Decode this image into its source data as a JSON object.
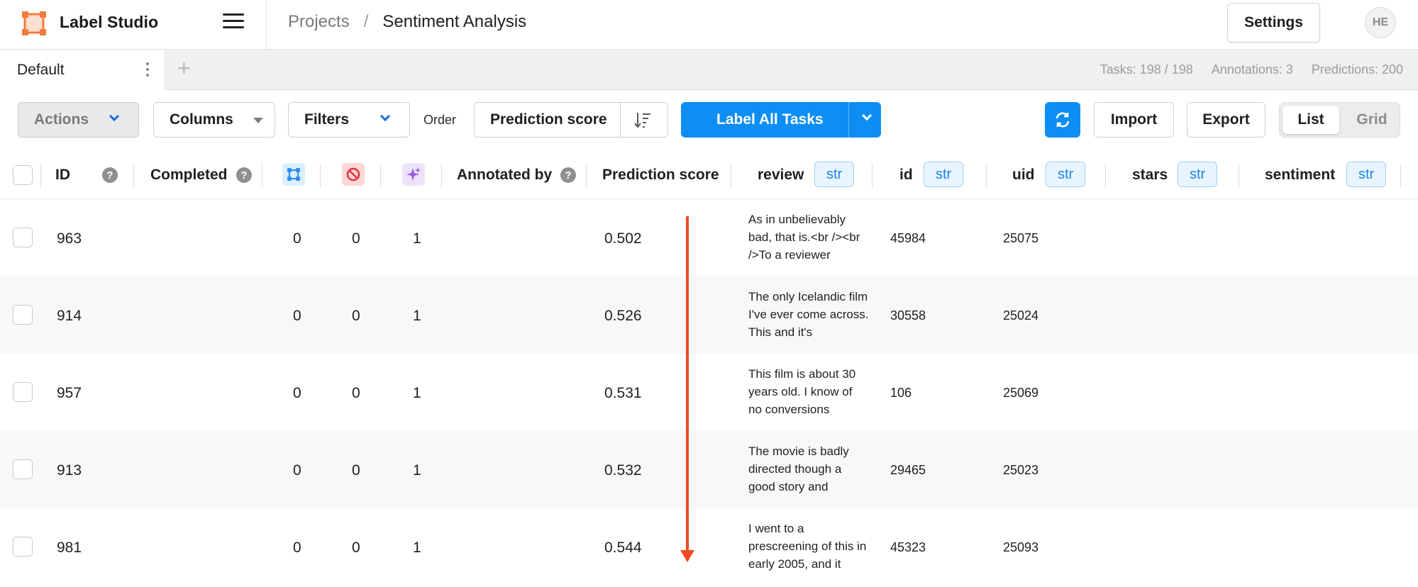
{
  "app": {
    "title": "Label Studio"
  },
  "breadcrumb": {
    "projects": "Projects",
    "separator": "/",
    "current": "Sentiment Analysis"
  },
  "header": {
    "settings_label": "Settings",
    "avatar_initials": "HE"
  },
  "tabs": {
    "active_label": "Default",
    "add_symbol": "+"
  },
  "stats": {
    "tasks": "Tasks: 198 / 198",
    "annotations": "Annotations: 3",
    "predictions": "Predictions: 200"
  },
  "toolbar": {
    "actions_label": "Actions",
    "columns_label": "Columns",
    "filters_label": "Filters",
    "order_label": "Order",
    "order_field": "Prediction score",
    "label_all_label": "Label All Tasks",
    "import_label": "Import",
    "export_label": "Export",
    "view_list_label": "List",
    "view_grid_label": "Grid",
    "accent_color": "#0c8ef5"
  },
  "table": {
    "columns": {
      "id": "ID",
      "completed": "Completed",
      "annotated_by": "Annotated by",
      "prediction_score": "Prediction score",
      "review": "review",
      "review_type": "str",
      "data_id": "id",
      "data_id_type": "str",
      "uid": "uid",
      "uid_type": "str",
      "stars": "stars",
      "stars_type": "str",
      "sentiment": "sentiment",
      "sentiment_type": "str",
      "help_symbol": "?"
    },
    "header_icons": [
      "annotations-count-icon",
      "cancelled-count-icon",
      "predictions-count-icon"
    ],
    "rows": [
      {
        "id": "963",
        "annotations": "0",
        "cancelled": "0",
        "predictions": "1",
        "score": "0.502",
        "review": "As in unbelievably bad, that is.<br /><br />To a reviewer",
        "data_id": "45984",
        "uid": "25075"
      },
      {
        "id": "914",
        "annotations": "0",
        "cancelled": "0",
        "predictions": "1",
        "score": "0.526",
        "review": "The only Icelandic film I've ever come across. This and it's",
        "data_id": "30558",
        "uid": "25024"
      },
      {
        "id": "957",
        "annotations": "0",
        "cancelled": "0",
        "predictions": "1",
        "score": "0.531",
        "review": "This film is about 30 years old. I know of no conversions",
        "data_id": "106",
        "uid": "25069"
      },
      {
        "id": "913",
        "annotations": "0",
        "cancelled": "0",
        "predictions": "1",
        "score": "0.532",
        "review": "The movie is badly directed though a good story and",
        "data_id": "29465",
        "uid": "25023"
      },
      {
        "id": "981",
        "annotations": "0",
        "cancelled": "0",
        "predictions": "1",
        "score": "0.544",
        "review": "I went to a prescreening of this in early 2005, and it",
        "data_id": "45323",
        "uid": "25093"
      }
    ]
  },
  "annotation_arrow_color": "#f04a22"
}
